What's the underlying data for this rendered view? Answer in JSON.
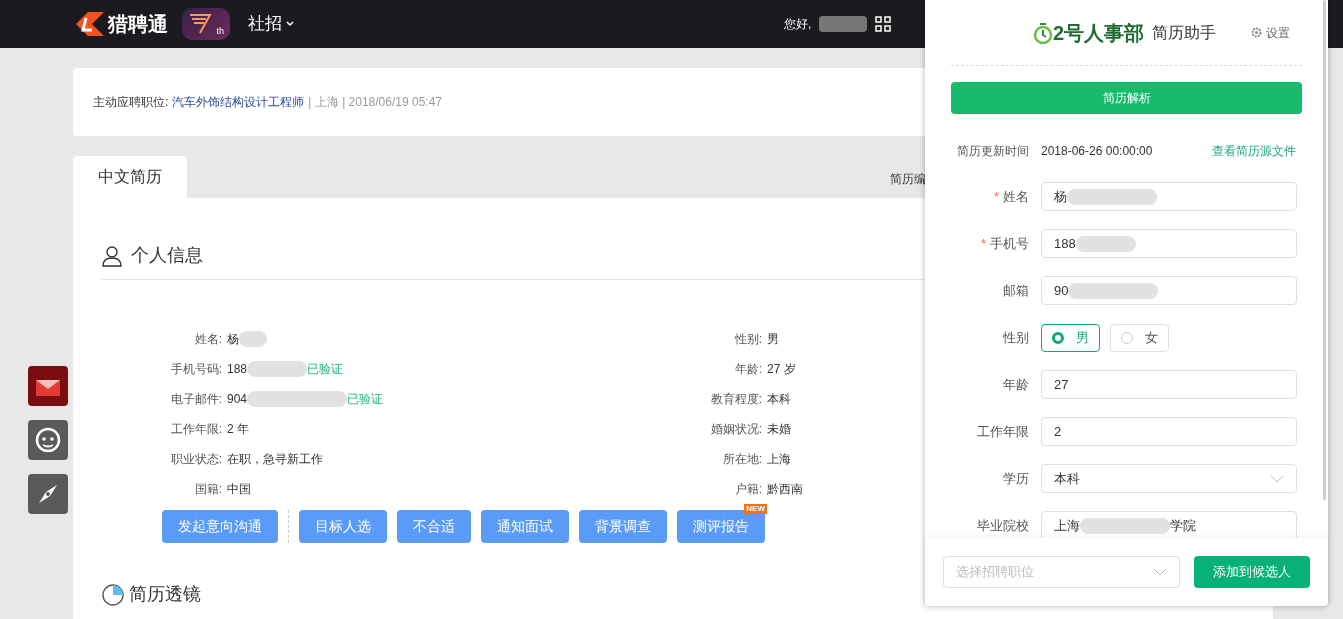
{
  "header": {
    "logo_text": "猎聘通",
    "badge_suffix": "th",
    "nav": "社招",
    "greeting": "您好,"
  },
  "application": {
    "label": "主动应聘职位:",
    "position": "汽车外饰结构设计工程师",
    "meta": "| 上海 | 2018/06/19 05:47"
  },
  "tabs": [
    {
      "label": "中文简历",
      "selected": true
    }
  ],
  "tab_bar_right": "简历编",
  "personal": {
    "title": "个人信息",
    "left": [
      {
        "label": "姓名:",
        "value": "杨",
        "blurred": true
      },
      {
        "label": "手机号码:",
        "value": "188",
        "blurred": true,
        "verified": "已验证"
      },
      {
        "label": "电子邮件:",
        "value": "904",
        "blurred": true,
        "verified": "已验证"
      },
      {
        "label": "工作年限:",
        "value": "2 年",
        "blurred": false
      },
      {
        "label": "职业状态:",
        "value": "在职，急寻新工作",
        "blurred": false
      },
      {
        "label": "国籍:",
        "value": "中国",
        "blurred": false
      }
    ],
    "right": [
      {
        "label": "性别:",
        "value": "男"
      },
      {
        "label": "年龄:",
        "value": "27 岁"
      },
      {
        "label": "教育程度:",
        "value": "本科"
      },
      {
        "label": "婚姻状况:",
        "value": "未婚"
      },
      {
        "label": "所在地:",
        "value": "上海"
      },
      {
        "label": "户籍:",
        "value": "黔西南"
      }
    ]
  },
  "actions": [
    {
      "label": "发起意向沟通"
    },
    {
      "label": "目标人选"
    },
    {
      "label": "不合适"
    },
    {
      "label": "通知面试"
    },
    {
      "label": "背景调查"
    },
    {
      "label": "测评报告",
      "badge": "NEW"
    }
  ],
  "lens_title": "简历透镜",
  "panel": {
    "brand": "2号人事部",
    "subtitle": "简历助手",
    "settings": "设置",
    "parse_button": "简历解析",
    "update_label": "简历更新时间",
    "update_time": "2018-06-26 00:00:00",
    "source_link": "查看简历源文件",
    "fields": [
      {
        "kind": "text",
        "label": "姓名",
        "required": true,
        "value": "杨",
        "blurred": true
      },
      {
        "kind": "text",
        "label": "手机号",
        "required": true,
        "value": "188",
        "blurred": true
      },
      {
        "kind": "text",
        "label": "邮箱",
        "required": false,
        "value": "90",
        "blurred": true
      },
      {
        "kind": "radio",
        "label": "性别",
        "required": false,
        "options": [
          {
            "label": "男",
            "selected": true
          },
          {
            "label": "女",
            "selected": false
          }
        ]
      },
      {
        "kind": "text",
        "label": "年龄",
        "required": false,
        "value": "27",
        "blurred": false
      },
      {
        "kind": "text",
        "label": "工作年限",
        "required": false,
        "value": "2",
        "blurred": false
      },
      {
        "kind": "select",
        "label": "学历",
        "required": false,
        "value": "本科"
      },
      {
        "kind": "text",
        "label": "毕业院校",
        "required": false,
        "value": "上海",
        "value_after": "学院",
        "blurred": true
      }
    ],
    "required_mark": "*",
    "position_placeholder": "选择招聘职位",
    "add_button": "添加到候选人"
  }
}
